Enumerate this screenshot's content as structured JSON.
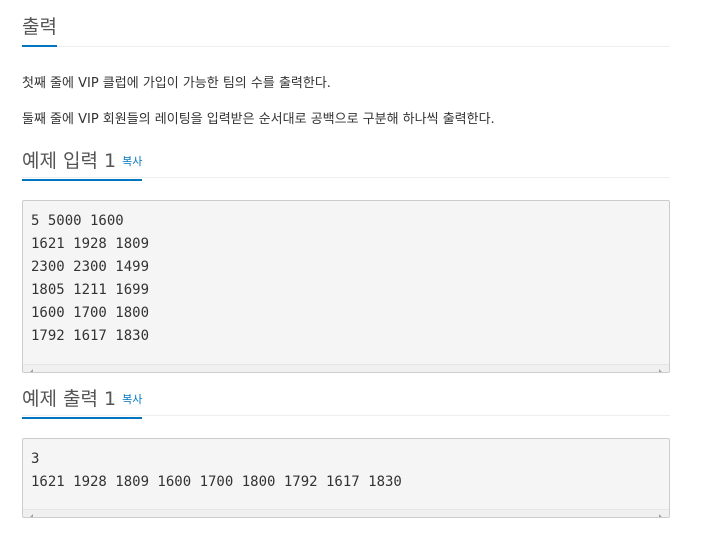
{
  "output_section": {
    "title": "출력",
    "lines": [
      "첫째 줄에 VIP 클럽에 가입이 가능한 팀의 수를 출력한다.",
      "둘째 줄에 VIP 회원들의 레이팅을 입력받은 순서대로 공백으로 구분해 하나씩 출력한다."
    ]
  },
  "sample_input": {
    "title": "예제 입력 1",
    "copy_label": "복사",
    "content": "5 5000 1600\n1621 1928 1809\n2300 2300 1499\n1805 1211 1699\n1600 1700 1800\n1792 1617 1830"
  },
  "sample_output": {
    "title": "예제 출력 1",
    "copy_label": "복사",
    "content": "3\n1621 1928 1809 1600 1700 1800 1792 1617 1830"
  },
  "icons": {
    "scroll_left": "scroll-left-arrow-icon",
    "scroll_right": "scroll-right-arrow-icon"
  },
  "colors": {
    "accent": "#0076c0",
    "code_bg": "#f5f5f5",
    "border": "#cccccc"
  }
}
